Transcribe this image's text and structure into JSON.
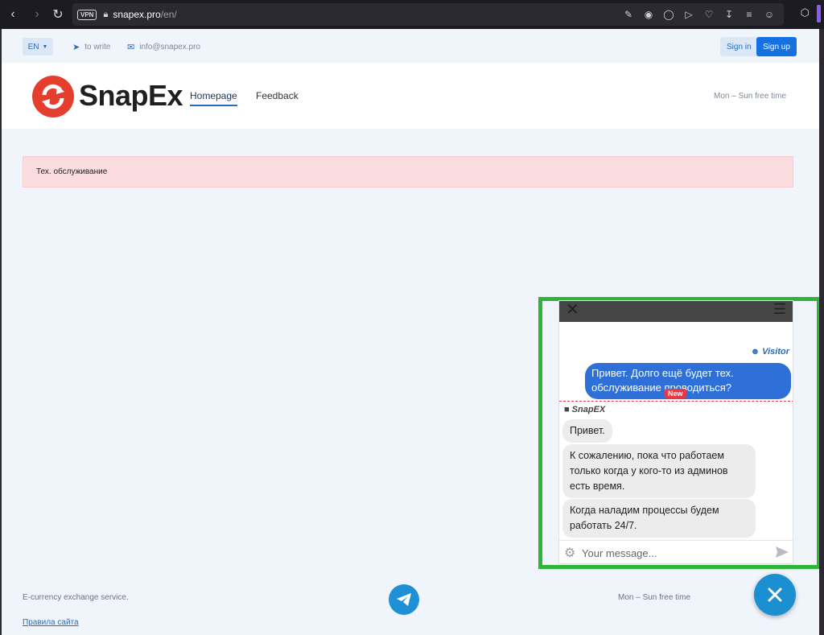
{
  "browser": {
    "vpn_label": "VPN",
    "url_host": "snapex.pro",
    "url_path": "/en/"
  },
  "topbar": {
    "lang": "EN",
    "write_link": "to write",
    "email": "info@snapex.pro",
    "signin": "Sign in",
    "signup": "Sign up"
  },
  "header": {
    "logo_text": "SnapEx",
    "nav": [
      "Homepage",
      "Feedback"
    ],
    "hours": "Mon – Sun free time"
  },
  "alert": {
    "text": "Тех. обслуживание"
  },
  "chat": {
    "visitor_label": "Visitor",
    "visitor_message": "Привет. Долго ещё будет тех. обслуживание проводиться?",
    "new_badge": "New",
    "agent_label": "SnapEX",
    "agent_messages": [
      "Привет.",
      "К сожалению, пока что работаем только когда у кого-то из админов есть время.",
      "Когда наладим процессы будем работать 24/7."
    ],
    "input_placeholder": "Your message..."
  },
  "footer": {
    "tagline": "E-currency exchange service.",
    "rules_link": "Правила сайта",
    "hours": "Mon – Sun free time"
  }
}
